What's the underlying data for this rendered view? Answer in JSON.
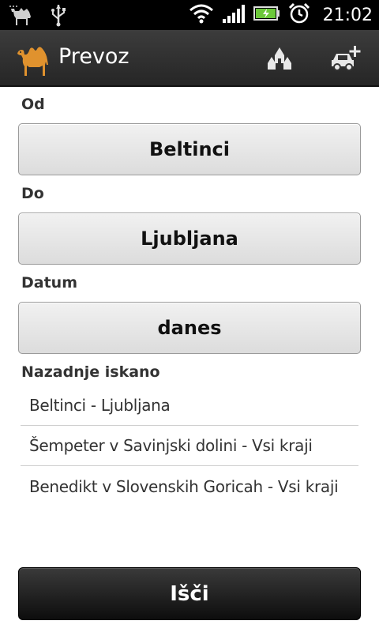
{
  "status_bar": {
    "time": "21:02"
  },
  "app": {
    "title": "Prevoz"
  },
  "form": {
    "from_label": "Od",
    "from_value": "Beltinci",
    "to_label": "Do",
    "to_value": "Ljubljana",
    "date_label": "Datum",
    "date_value": "danes"
  },
  "recent": {
    "header": "Nazadnje iskano",
    "items": [
      "Beltinci - Ljubljana",
      "Šempeter v Savinjski dolini - Vsi kraji",
      "Benedikt v Slovenskih Goricah - Vsi kraji"
    ]
  },
  "search_button": "Išči",
  "icons": {
    "status_left": [
      "camel-notification-icon",
      "usb-icon"
    ],
    "status_right": [
      "wifi-icon",
      "signal-icon",
      "battery-charging-icon",
      "alarm-icon"
    ],
    "actionbar": [
      "camel-logo-icon",
      "stations-icon",
      "add-car-icon"
    ]
  },
  "colors": {
    "logo": "#e0922e",
    "battery": "#6cc83a"
  }
}
